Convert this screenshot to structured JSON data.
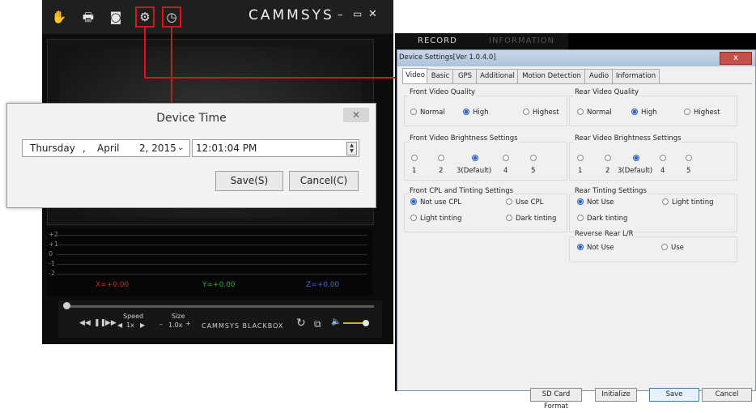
{
  "player": {
    "brand": "CAMMSYS",
    "toolbar_icons": [
      "hand-icon",
      "print-icon",
      "camera-icon",
      "settings-icon",
      "clock-icon"
    ],
    "window_controls": {
      "minimize": "–",
      "maximize": "▭",
      "close": "✕"
    },
    "graph_y_labels": [
      "+2",
      "+1",
      "0",
      "-1",
      "-2"
    ],
    "axis_values": {
      "x": "X=+0.00",
      "y": "Y=+0.00",
      "z": "Z=+0.00"
    },
    "controls": {
      "speed_label": "Speed",
      "speed_value": "1x",
      "size_label": "Size",
      "size_value": "1.0x",
      "footer_brand": "CAMMSYS BLACKBOX"
    },
    "colors": {
      "x": "#d8242a",
      "y": "#2eb12e",
      "z": "#4660d8",
      "highlight": "#d0181e"
    }
  },
  "device_time": {
    "title": "Device Time",
    "date": {
      "weekday": "Thursday",
      "sep": ",",
      "month": "April",
      "day_year": "2, 2015"
    },
    "time": "12:01:04 PM",
    "save_label": "Save(S)",
    "cancel_label": "Cancel(C)"
  },
  "device_settings": {
    "player_tabs": {
      "record": "RECORD",
      "information": "INFORMATION"
    },
    "caption": "Device Settings[Ver 1.0.4.0]",
    "close": "x",
    "tabs": [
      "Video",
      "Basic",
      "GPS",
      "Additional",
      "Motion Detection",
      "Audio",
      "Information"
    ],
    "front_quality": {
      "title": "Front Video Quality",
      "options": [
        "Normal",
        "High",
        "Highest"
      ],
      "selected": 1
    },
    "rear_quality": {
      "title": "Rear Video Quality",
      "options": [
        "Normal",
        "High",
        "Highest"
      ],
      "selected": 1
    },
    "front_brightness": {
      "title": "Front Video Brightness Settings",
      "labels": [
        "1",
        "2",
        "3(Default)",
        "4",
        "5"
      ],
      "selected": 2
    },
    "rear_brightness": {
      "title": "Rear Video Brightness Settings",
      "labels": [
        "1",
        "2",
        "3(Default)",
        "4",
        "5"
      ],
      "selected": 2
    },
    "front_cpl": {
      "title": "Front CPL and Tinting Settings",
      "options": [
        "Not use CPL",
        "Use CPL",
        "Light tinting",
        "Dark tinting"
      ],
      "selected": 0
    },
    "rear_tint": {
      "title": "Rear Tinting Settings",
      "options": [
        "Not Use",
        "Light tinting",
        "Dark tinting"
      ],
      "selected": 0
    },
    "reverse": {
      "title": "Reverse Rear L/R",
      "options": [
        "Not Use",
        "Use"
      ],
      "selected": 0
    },
    "buttons": {
      "sd_format": "SD Card Format",
      "initialize": "Initialize",
      "save": "Save",
      "cancel": "Cancel"
    }
  }
}
